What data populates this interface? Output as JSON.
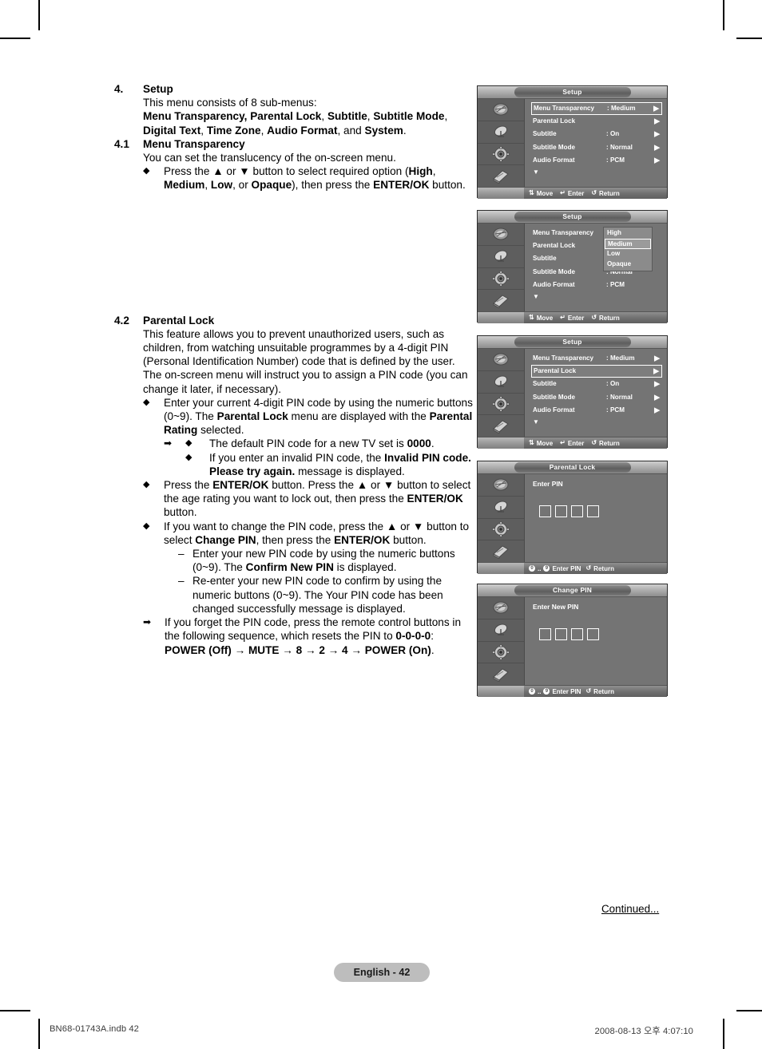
{
  "page": {
    "badge": "English - 42",
    "continued": "Continued...",
    "indb": "BN68-01743A.indb   42",
    "date": "2008-08-13   오후 4:07:10"
  },
  "sections": [
    {
      "number": "4.",
      "title": "Setup",
      "lines": [
        "This menu consists of 8 sub-menus:"
      ],
      "bold_line_a": "Menu Transparency, Parental Lock",
      "bold_line_b": "Subtitle",
      "bold_line_c": "Subtitle Mode",
      "bold_line_d": "Digital Text",
      "bold_line_e": "Time Zone",
      "bold_line_f": "Audio Format",
      "bold_line_g": "System"
    },
    {
      "number": "4.1",
      "title": "Menu Transparency",
      "line1": "You can set the translucency of the on-screen menu.",
      "bullet": {
        "t1": "Press the ▲ or ▼ button to select required option (",
        "b1": "High",
        "t2": ", ",
        "b2": "Medium",
        "t3": ", ",
        "b3": "Low",
        "t4": ", or ",
        "b4": "Opaque",
        "t5": "), then press the ",
        "b5": "ENTER/OK",
        "t6": " button."
      }
    },
    {
      "number": "4.2",
      "title": "Parental Lock",
      "para1": "This feature allows you to prevent unauthorized users, such as children, from watching unsuitable programmes by a 4-digit PIN (Personal Identification Number) code that is defined by the user.",
      "para2": "The on-screen menu will instruct you to assign a PIN code (you can change it later, if necessary).",
      "b1_t1": "Enter your current 4-digit PIN code by using the numeric buttons (0~9). The ",
      "b1_b1": "Parental Lock",
      "b1_t2": " menu are displayed with the ",
      "b1_b2": "Parental Rating",
      "b1_t3": " selected.",
      "note1_t1": "The default PIN code for a new TV set is ",
      "note1_b1": "0000",
      "note1_t2": ".",
      "note2_t1": "If you enter an invalid PIN code, the ",
      "note2_b1": "Invalid PIN code. Please try again.",
      "note2_t2": " message is displayed.",
      "b2_t1": "Press the ",
      "b2_b1": "ENTER/OK",
      "b2_t2": " button. Press the ▲ or ▼ button to select the age rating you want to lock out, then press the ",
      "b2_b2": "ENTER/OK",
      "b2_t3": " button.",
      "b3_t1": "If you want to change the PIN code, press the ▲ or ▼ button to select ",
      "b3_b1": "Change PIN",
      "b3_t2": ", then press the ",
      "b3_b2": "ENTER/OK",
      "b3_t3": " button.",
      "d1_t1": "Enter your new PIN code by using the numeric buttons (0~9). The ",
      "d1_b1": "Confirm New PIN",
      "d1_t2": " is displayed.",
      "d2_t1": "Re-enter your new PIN code to confirm by using the numeric buttons (0~9). The Your PIN code has been changed successfully message is displayed.",
      "note3_t1": "If you forget the PIN code, press the remote control buttons in the following sequence, which resets the PIN to ",
      "note3_b1": "0-0-0-0",
      "note3_t2": ":",
      "note3_b2": "POWER (Off) → MUTE → 8 → 2 → 4 → POWER (On)",
      "note3_t3": "."
    }
  ],
  "osd": {
    "icons": [
      "picture-icon",
      "satellite-dish-icon",
      "setup-gear-icon",
      "input-remote-icon"
    ],
    "footer_move": "Move",
    "footer_enter": "Enter",
    "footer_return": "Return",
    "footer_enter_pin": "Enter PIN",
    "footer_pin_range": "..",
    "panels": [
      {
        "title": "Setup",
        "rows": [
          {
            "label": "Menu Transparency",
            "value": ": Medium",
            "arrow": "▶",
            "selected": true
          },
          {
            "label": "Parental Lock",
            "value": "",
            "arrow": "▶",
            "selected": false
          },
          {
            "label": "Subtitle",
            "value": ": On",
            "arrow": "▶",
            "selected": false
          },
          {
            "label": "Subtitle Mode",
            "value": ": Normal",
            "arrow": "▶",
            "selected": false
          },
          {
            "label": "Audio Format",
            "value": ": PCM",
            "arrow": "▶",
            "selected": false
          }
        ],
        "more_caret": "▼"
      },
      {
        "title": "Setup",
        "rows": [
          {
            "label": "Menu Transparency",
            "value": ":",
            "arrow": "",
            "selected": false
          },
          {
            "label": "Parental Lock",
            "value": "",
            "arrow": "",
            "selected": false
          },
          {
            "label": "Subtitle",
            "value": ":",
            "arrow": "",
            "selected": false
          },
          {
            "label": "Subtitle Mode",
            "value": ": Normal",
            "arrow": "",
            "selected": false
          },
          {
            "label": "Audio Format",
            "value": ": PCM",
            "arrow": "",
            "selected": false
          }
        ],
        "more_caret": "▼",
        "dropdown": {
          "options": [
            "High",
            "Medium",
            "Low",
            "Opaque"
          ],
          "selected_index": 1
        }
      },
      {
        "title": "Setup",
        "rows": [
          {
            "label": "Menu Transparency",
            "value": ": Medium",
            "arrow": "▶",
            "selected": false
          },
          {
            "label": "Parental Lock",
            "value": "",
            "arrow": "▶",
            "selected": true
          },
          {
            "label": "Subtitle",
            "value": ": On",
            "arrow": "▶",
            "selected": false
          },
          {
            "label": "Subtitle Mode",
            "value": ": Normal",
            "arrow": "▶",
            "selected": false
          },
          {
            "label": "Audio Format",
            "value": ": PCM",
            "arrow": "▶",
            "selected": false
          }
        ],
        "more_caret": "▼"
      },
      {
        "title": "Parental Lock",
        "pin_label": "Enter PIN",
        "pin_digits": 4
      },
      {
        "title": "Change PIN",
        "pin_label": "Enter New PIN",
        "pin_digits": 4
      }
    ]
  }
}
